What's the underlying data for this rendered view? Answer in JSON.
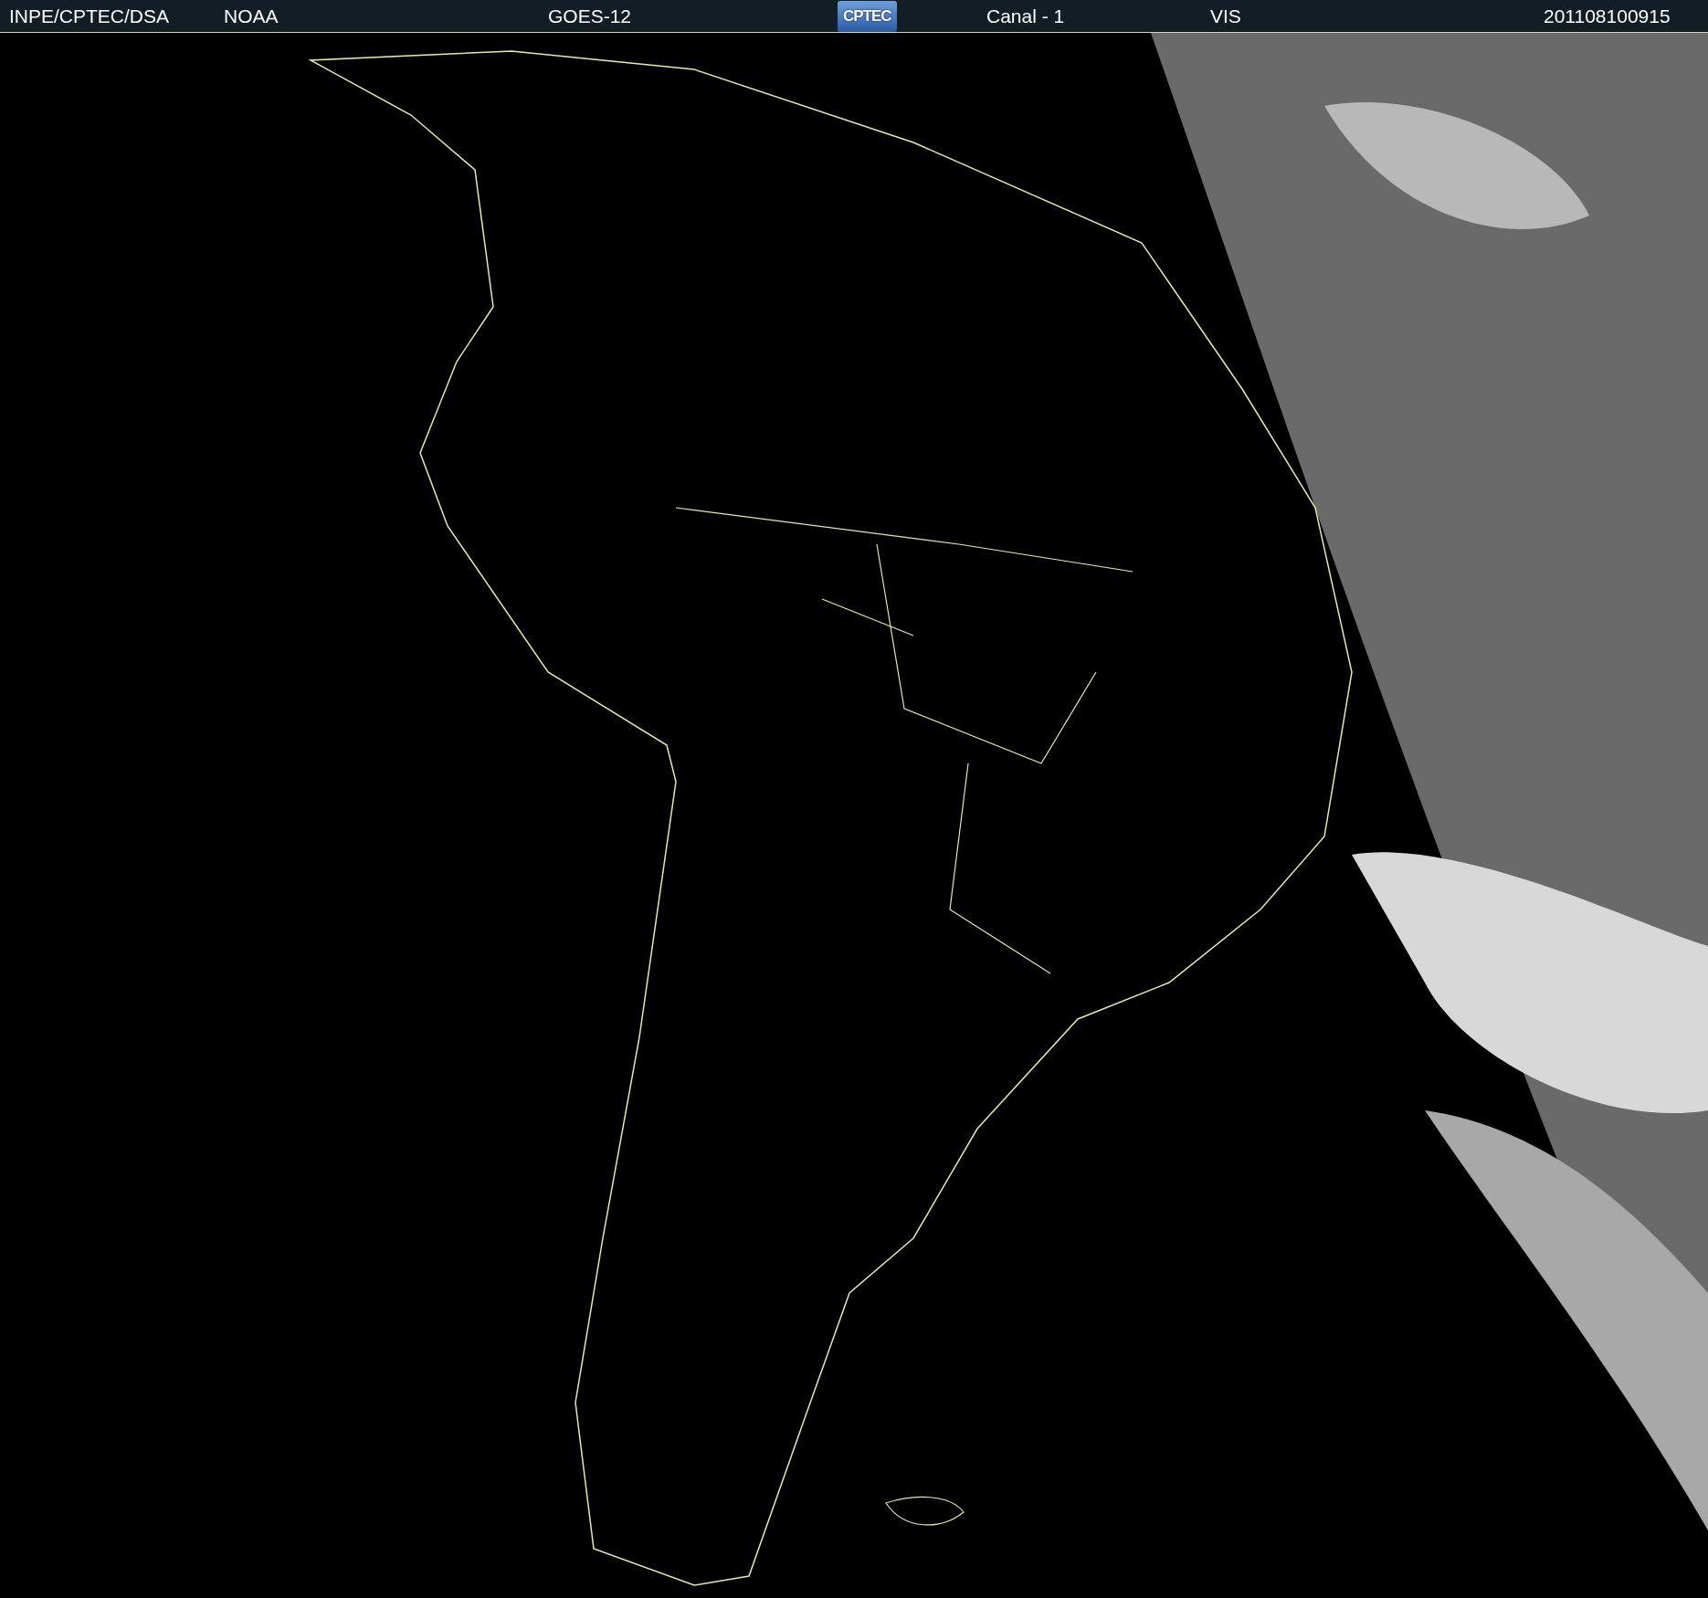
{
  "header": {
    "items": [
      {
        "kind": "text",
        "label": "INPE/CPTEC/DSA"
      },
      {
        "kind": "text",
        "label": "NOAA"
      },
      {
        "kind": "text",
        "label": "GOES-12"
      },
      {
        "kind": "logo",
        "label": "CPTEC"
      },
      {
        "kind": "text",
        "label": "Canal - 1"
      },
      {
        "kind": "text",
        "label": "VIS"
      },
      {
        "kind": "text",
        "label": "201108100915"
      }
    ]
  }
}
